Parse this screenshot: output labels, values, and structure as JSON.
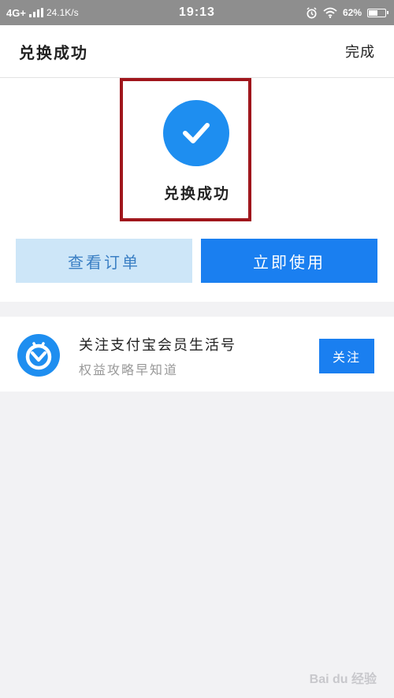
{
  "status_bar": {
    "network": "4G+",
    "speed": "24.1K/s",
    "time": "19:13",
    "battery": "62%",
    "battery_level": 0.62,
    "icons": [
      "signal-icon",
      "alarm-icon",
      "wifi-icon",
      "battery-icon"
    ]
  },
  "header": {
    "title": "兑换成功",
    "done_label": "完成"
  },
  "success": {
    "icon": "check-circle-icon",
    "message": "兑换成功",
    "highlight_color": "#a0161c"
  },
  "actions": {
    "view_order_label": "查看订单",
    "use_now_label": "立即使用"
  },
  "follow": {
    "logo_icon": "alipay-member-logo-icon",
    "title": "关注支付宝会员生活号",
    "subtitle": "权益攻略早知道",
    "button_label": "关注"
  },
  "colors": {
    "primary": "#1a7ff0",
    "primary_light": "#cde6f8",
    "background": "#f2f2f4"
  },
  "watermark": {
    "text": "Bai du 经验"
  }
}
